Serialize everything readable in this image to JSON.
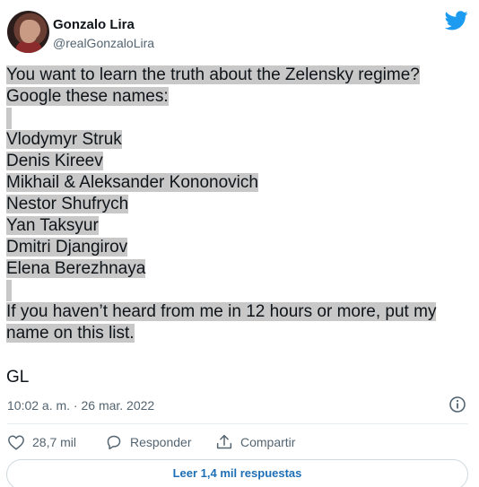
{
  "author": {
    "name": "Gonzalo Lira",
    "handle": "@realGonzaloLira"
  },
  "tweet": {
    "lines": [
      "You want to learn the truth about the Zelensky regime?",
      "Google these names:",
      "",
      "Vlodymyr Struk",
      "Denis Kireev",
      "Mikhail & Aleksander Kononovich",
      "Nestor Shufrych",
      "Yan Taksyur",
      "Dmitri Djangirov",
      "Elena Berezhnaya",
      "",
      "If you haven’t heard from me in 12 hours or more, put my",
      "name on this list."
    ],
    "signoff": "GL",
    "timestamp": "10:02 a. m. · 26 mar. 2022"
  },
  "actions": {
    "likes": "28,7 mil",
    "reply_label": "Responder",
    "share_label": "Compartir"
  },
  "read_replies_label": "Leer 1,4 mil respuestas",
  "colors": {
    "brand": "#1d9bf0",
    "highlight": "#c8c8c8",
    "muted": "#536471",
    "link": "#1d6fb5"
  },
  "icons": [
    "twitter-bird-icon",
    "info-icon",
    "heart-icon",
    "reply-icon",
    "share-icon"
  ]
}
